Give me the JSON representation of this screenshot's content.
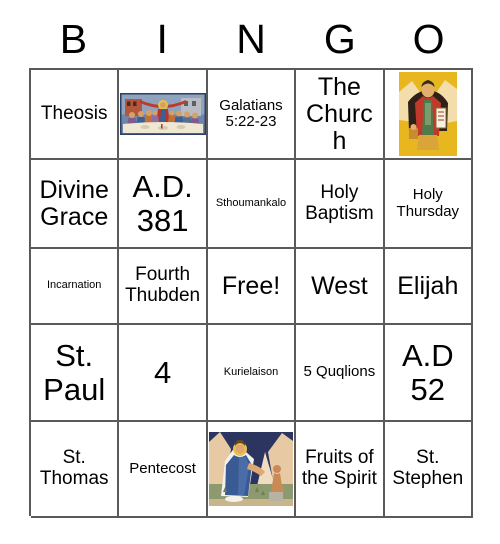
{
  "card": {
    "header_letters": [
      "B",
      "I",
      "N",
      "G",
      "O"
    ],
    "columns": 5,
    "rows": 5,
    "free_space_label": "Free!",
    "colors": {
      "grid_line": "#5a5a5a",
      "background": "#ffffff",
      "text": "#000000",
      "icon_gold": "#e8b720",
      "icon_red": "#c0392b",
      "icon_blue": "#2b3f6b"
    },
    "cells": [
      [
        {
          "type": "text",
          "label": "Theosis",
          "size": "md"
        },
        {
          "type": "image",
          "label": "last-supper-icon",
          "art": "lastsupper"
        },
        {
          "type": "text",
          "label": "Galatians 5:22-23",
          "size": "sm"
        },
        {
          "type": "text",
          "label": "The Church",
          "size": "lg"
        },
        {
          "type": "image",
          "label": "elijah-prophet-icon",
          "art": "elijah"
        }
      ],
      [
        {
          "type": "text",
          "label": "Divine Grace",
          "size": "lg"
        },
        {
          "type": "text",
          "label": "A.D. 381",
          "size": "xl"
        },
        {
          "type": "text",
          "label": "Sthoumankalo",
          "size": "xs"
        },
        {
          "type": "text",
          "label": "Holy Baptism",
          "size": "md"
        },
        {
          "type": "text",
          "label": "Holy Thursday",
          "size": "sm"
        }
      ],
      [
        {
          "type": "text",
          "label": "Incarnation",
          "size": "xs"
        },
        {
          "type": "text",
          "label": "Fourth Thubden",
          "size": "md"
        },
        {
          "type": "text",
          "label": "Free!",
          "size": "lg"
        },
        {
          "type": "text",
          "label": "West",
          "size": "lg"
        },
        {
          "type": "text",
          "label": "Elijah",
          "size": "lg"
        }
      ],
      [
        {
          "type": "text",
          "label": "St. Paul",
          "size": "xl"
        },
        {
          "type": "text",
          "label": "4",
          "size": "xl"
        },
        {
          "type": "text",
          "label": "Kurielaison",
          "size": "xs"
        },
        {
          "type": "text",
          "label": "5 Quqlions",
          "size": "sm"
        },
        {
          "type": "text",
          "label": "A.D 52",
          "size": "xl"
        }
      ],
      [
        {
          "type": "text",
          "label": "St. Thomas",
          "size": "md"
        },
        {
          "type": "text",
          "label": "Pentecost",
          "size": "sm"
        },
        {
          "type": "image",
          "label": "theophany-icon",
          "art": "theophany"
        },
        {
          "type": "text",
          "label": "Fruits of the Spirit",
          "size": "md"
        },
        {
          "type": "text",
          "label": "St. Stephen",
          "size": "md"
        }
      ]
    ]
  }
}
